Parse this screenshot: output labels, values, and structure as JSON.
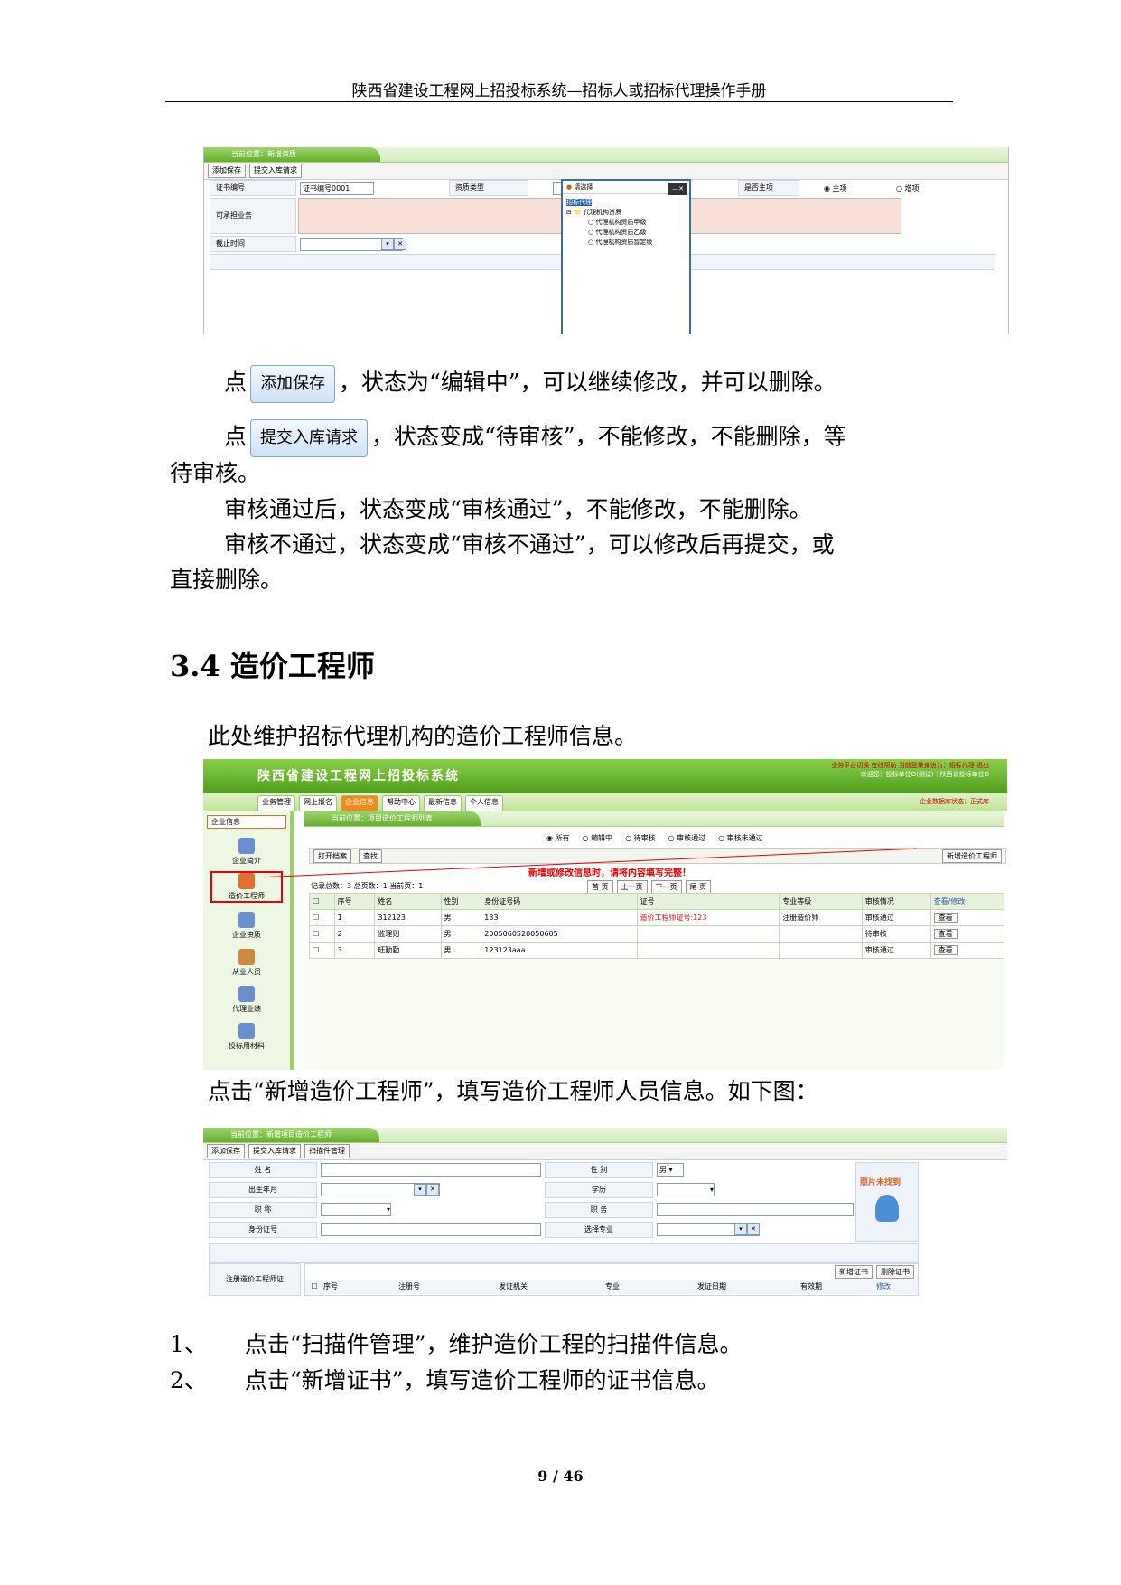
{
  "header": "陕西省建设工程网上招投标系统—招标人或招标代理操作手册",
  "shot1": {
    "crumb": "当前位置：新增资质",
    "toolbar": [
      "添加保存",
      "提交入库请求"
    ],
    "labels": {
      "cert_no": "证书编号",
      "qual_type": "资质类型",
      "is_main": "是否主项",
      "scope": "可承担业务",
      "expire": "截止时间"
    },
    "cert_value": "证书编号0001",
    "radio_main": "主项",
    "radio_sub": "增项",
    "popup_title": "请选择",
    "tree": [
      "招标代理",
      "代理机构资质",
      "代理机构资质甲级",
      "代理机构资质乙级",
      "代理机构资质暂定级"
    ]
  },
  "p1": {
    "pre": "点",
    "btn": "添加保存",
    "post": "，状态为“编辑中”，可以继续修改，并可以删除。"
  },
  "p2": {
    "pre": "点",
    "btn": "提交入库请求",
    "post": "，状态变成“待审核”，不能修改，不能删除，等",
    "cont": "待审核。"
  },
  "p3": "审核通过后，状态变成“审核通过”，不能修改，不能删除。",
  "p4": {
    "line1": "审核不通过，状态变成“审核不通过”，可以修改后再提交，或",
    "line2": "直接删除。"
  },
  "section": "3.4 造价工程师",
  "p5": "此处维护招标代理机构的造价工程师信息。",
  "shot2": {
    "title": "陕西省建设工程网上招投标系统",
    "top_right1": "业务平台切换 在线帮助 当前登录身份为：招标代理 退出",
    "top_right2": "欢迎您：投标单位O(测试)｜陕西省投标单位D",
    "top_right3": "企业数据库状态：正式库",
    "tabs": [
      "业务管理",
      "网上报名",
      "企业信息",
      "帮助中心",
      "最新信息",
      "个人信息"
    ],
    "side_title": "企业信息",
    "side": [
      "企业简介",
      "造价工程师",
      "企业资质",
      "从业人员",
      "代理业绩",
      "投标用材料"
    ],
    "crumb": "当前位置：项目造价工程师列表",
    "filters": [
      "所有",
      "编辑中",
      "待审核",
      "审核通过",
      "审核未通过"
    ],
    "btns": [
      "打开档案",
      "查找"
    ],
    "new_btn": "新增造价工程师",
    "note": "新增或修改信息时，请将内容填写完整！",
    "records": "记录总数：3 总页数：1 当前页：1",
    "pager": [
      "首 页",
      "上一页",
      "下一页",
      "尾 页"
    ],
    "cols": [
      "",
      "序号",
      "姓名",
      "性别",
      "身份证号码",
      "证号",
      "专业等级",
      "审核情况",
      "查看/修改"
    ],
    "rows": [
      [
        "",
        "1",
        "312123",
        "男",
        "133",
        "造价工程师证号:123",
        "注册造价师",
        "审核通过",
        "查看"
      ],
      [
        "",
        "2",
        "监理则",
        "男",
        "2005060520050605",
        "",
        "",
        "待审核",
        "查看"
      ],
      [
        "",
        "3",
        "旺勤勤",
        "男",
        "123123aaa",
        "",
        "",
        "审核通过",
        "查看"
      ]
    ]
  },
  "p6": "点击“新增造价工程师”，填写造价工程师人员信息。如下图：",
  "shot3": {
    "crumb": "当前位置：新增项目造价工程师",
    "toolbar": [
      "添加保存",
      "提交入库请求",
      "扫描件管理"
    ],
    "labels": [
      "姓  名",
      "出生年月",
      "职  称",
      "身份证号",
      "性  别",
      "学历",
      "职  务",
      "选择专业"
    ],
    "gender": "男",
    "photo_missing": "照片未找到",
    "cert_label": "注册造价工程师证",
    "cert_btns": [
      "新增证书",
      "删除证书"
    ],
    "cert_cols": [
      "序号",
      "注册号",
      "发证机关",
      "专业",
      "发证日期",
      "有效期",
      "修改"
    ]
  },
  "list": [
    {
      "num": "1、",
      "text": "点击“扫描件管理”，维护造价工程的扫描件信息。"
    },
    {
      "num": "2、",
      "text": "点击“新增证书”，填写造价工程师的证书信息。"
    }
  ],
  "footer": "9 / 46"
}
